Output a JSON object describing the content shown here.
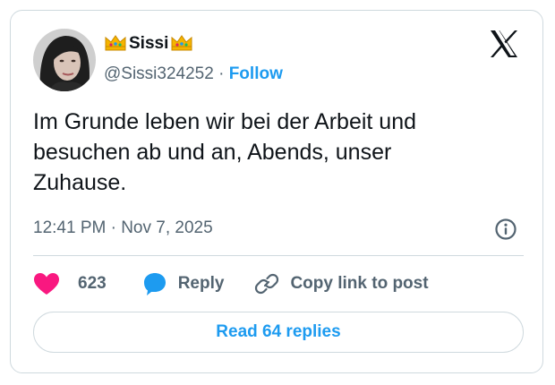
{
  "author": {
    "display_name": "Sissi",
    "name_decoration_icon": "crown-icon",
    "handle": "@Sissi324252",
    "separator": " · ",
    "follow_label": "Follow",
    "avatar": "profile-photo"
  },
  "platform": {
    "logo_icon": "x-logo-icon"
  },
  "tweet": {
    "text": "Im Grunde leben wir bei der Arbeit und\nbesuchen ab und an, Abends, unser\nZuhause.",
    "timestamp": "12:41 PM · Nov 7, 2025"
  },
  "actions": {
    "like_count": "623",
    "reply_label": "Reply",
    "copy_link_label": "Copy link to post",
    "read_replies_label": "Read 64 replies"
  },
  "colors": {
    "accent": "#1d9bf0",
    "like": "#f91880",
    "text": "#0f1419",
    "secondary_text": "#536471",
    "border": "#cfd9de"
  }
}
